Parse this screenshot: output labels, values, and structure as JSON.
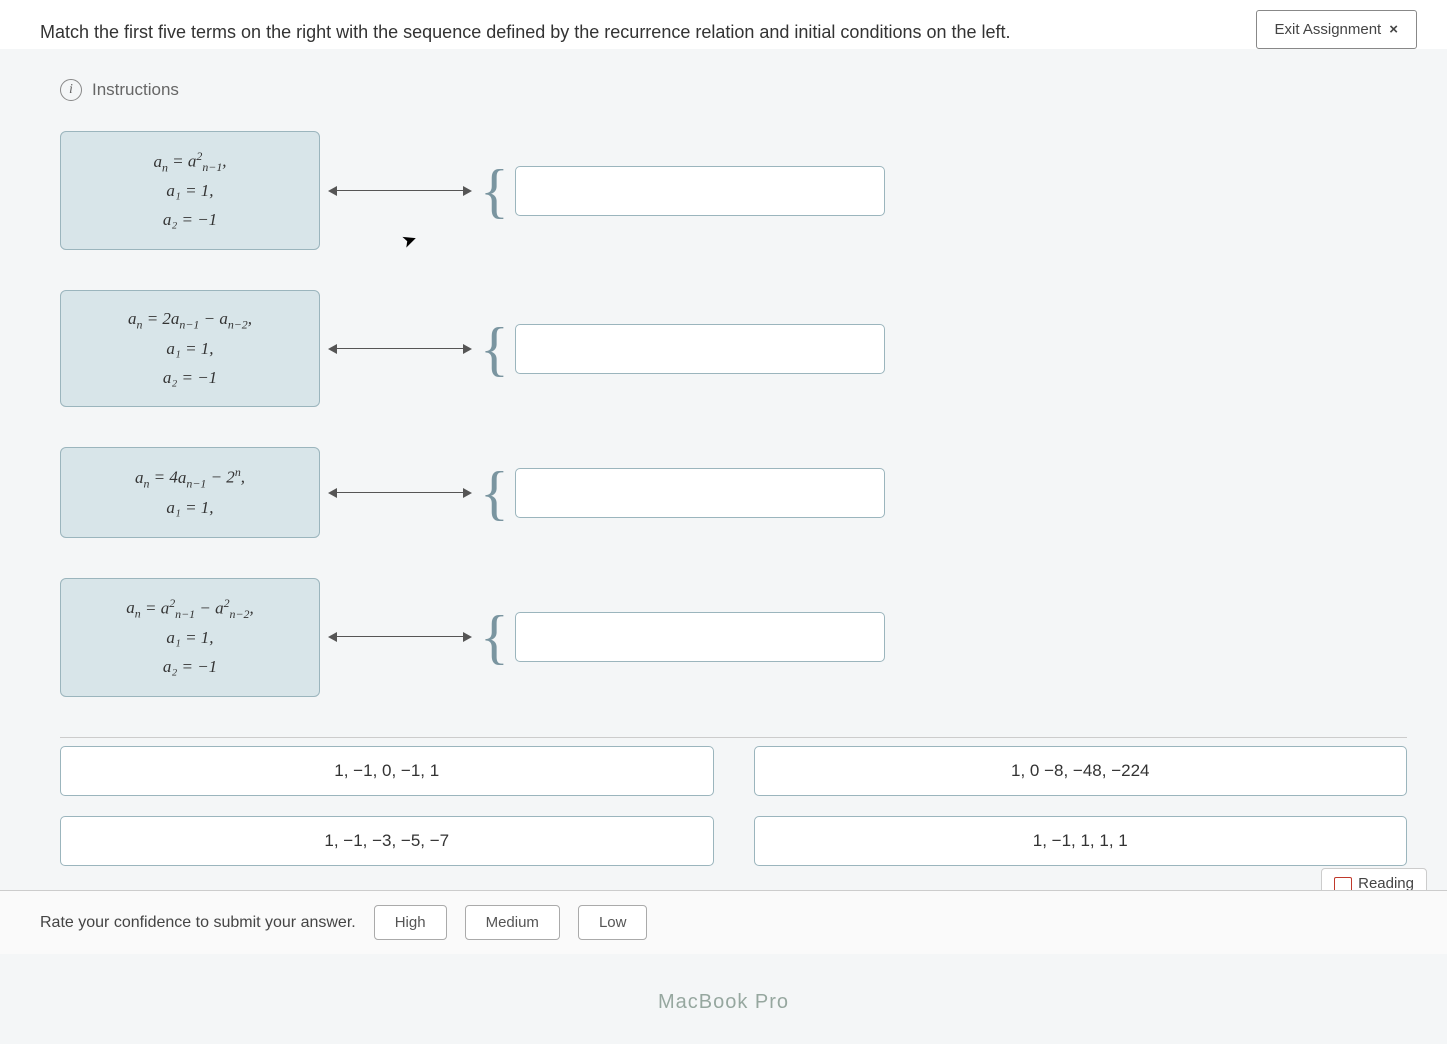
{
  "header": {
    "question": "Match the first five terms on the right with the sequence defined by the recurrence relation and initial conditions on the left.",
    "exit_label": "Exit Assignment",
    "exit_x": "×"
  },
  "instructions_label": "Instructions",
  "recurrences": [
    {
      "line1": "aₙ = a²ₙ₋₁,",
      "line2": "a₁ = 1,",
      "line3": "a₂ = −1"
    },
    {
      "line1": "aₙ = 2aₙ₋₁ − aₙ₋₂,",
      "line2": "a₁ = 1,",
      "line3": "a₂ = −1"
    },
    {
      "line1": "aₙ = 4aₙ₋₁ − 2ⁿ,",
      "line2": "a₁ = 1,",
      "line3": ""
    },
    {
      "line1": "aₙ = a²ₙ₋₁ − a²ₙ₋₂,",
      "line2": "a₁ = 1,",
      "line3": "a₂ = −1"
    }
  ],
  "answers": [
    "1, −1, 0, −1, 1",
    "1, 0 −8, −48, −224",
    "1, −1, −3, −5, −7",
    "1, −1, 1, 1, 1"
  ],
  "confidence": {
    "prompt": "Rate your confidence to submit your answer.",
    "high": "High",
    "medium": "Medium",
    "low": "Low"
  },
  "reading_label": "Reading",
  "macbook": "MacBook Pro"
}
